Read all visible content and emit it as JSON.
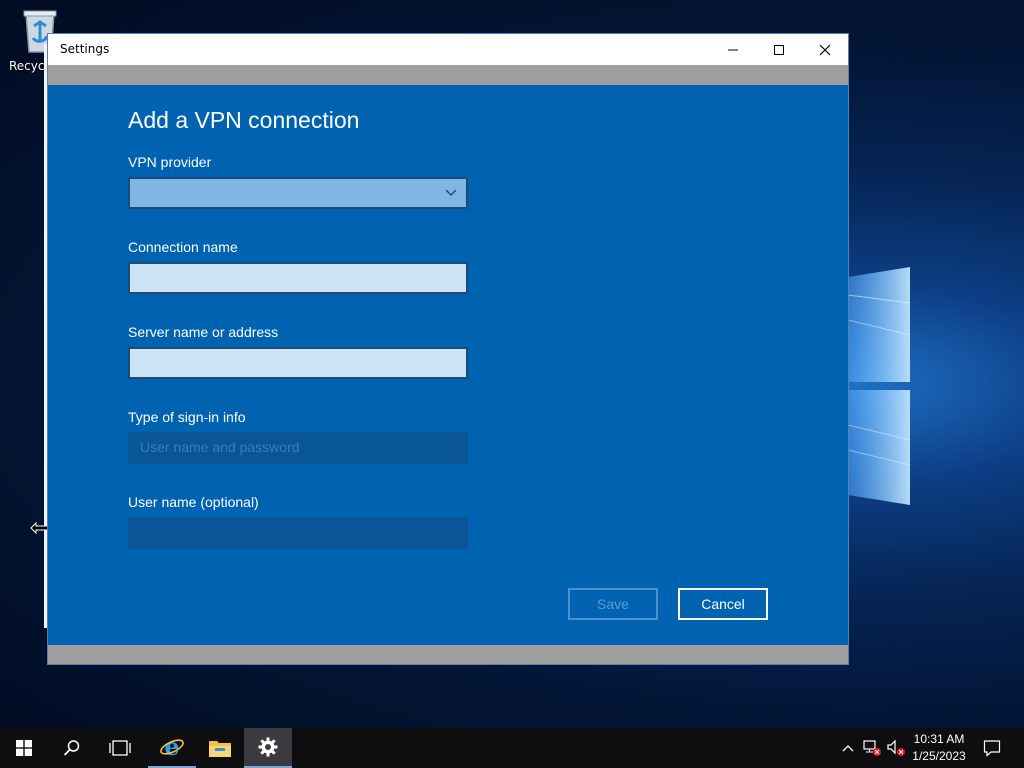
{
  "desktop": {
    "recycle_bin_label": "Recycl"
  },
  "window": {
    "title": "Settings",
    "controls": [
      "minimize",
      "maximize",
      "close"
    ]
  },
  "form": {
    "heading": "Add a VPN connection",
    "vpn_provider_label": "VPN provider",
    "vpn_provider_value": "",
    "connection_name_label": "Connection name",
    "connection_name_value": "",
    "server_label": "Server name or address",
    "server_value": "",
    "signin_type_label": "Type of sign-in info",
    "signin_type_value": "User name and password",
    "user_name_label": "User name (optional)",
    "user_name_value": "",
    "save_label": "Save",
    "save_enabled": false,
    "cancel_label": "Cancel"
  },
  "taskbar": {
    "items": [
      {
        "icon": "start-windows-icon"
      },
      {
        "icon": "search-icon"
      },
      {
        "icon": "task-view-icon"
      },
      {
        "icon": "internet-explorer-icon"
      },
      {
        "icon": "file-explorer-icon"
      },
      {
        "icon": "settings-gear-icon",
        "active": true
      }
    ],
    "tray": {
      "icons": [
        "chevron-up-icon",
        "network-disconnected-icon",
        "volume-muted-icon",
        "notification-icon"
      ],
      "time": "10:31 AM",
      "date": "1/25/2023"
    }
  },
  "colors": {
    "accent": "#0063b1",
    "field_active": "#cce4f4",
    "field_disabled": "#0a5595",
    "taskbar": "#0e0e10"
  }
}
